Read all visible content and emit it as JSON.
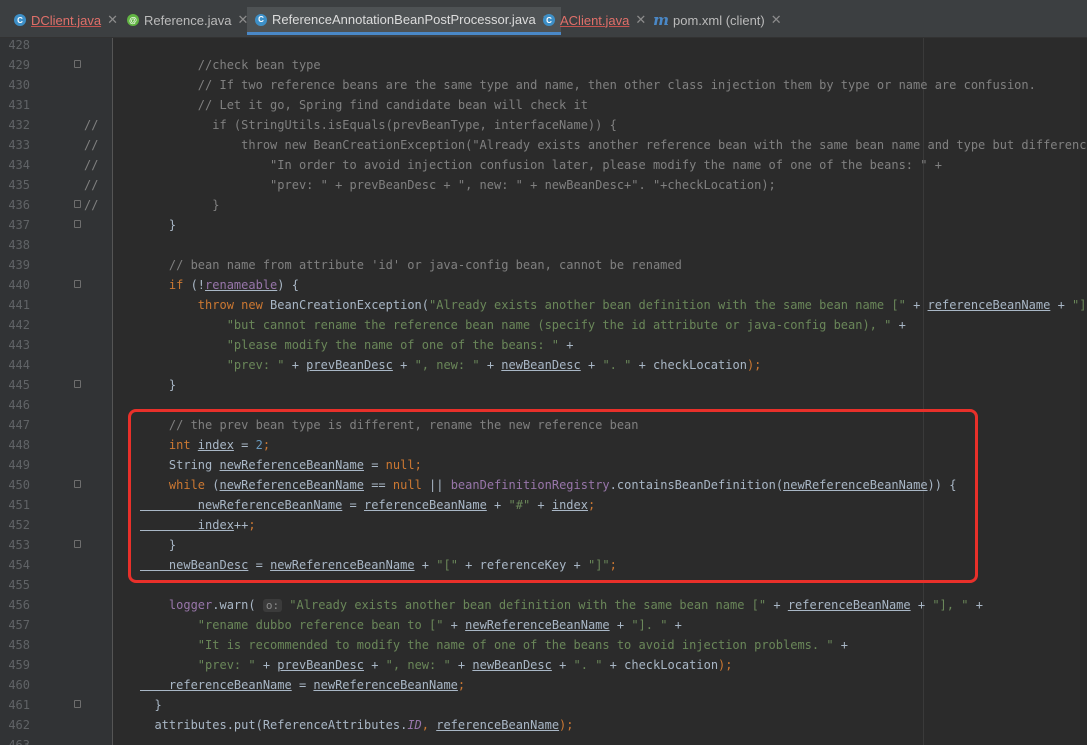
{
  "tabs": [
    {
      "label": "DClient.java",
      "icon": "class-icon",
      "glyph": "C",
      "modified": true,
      "active": false
    },
    {
      "label": "Reference.java",
      "icon": "annotation-icon",
      "glyph": "@",
      "modified": false,
      "active": false
    },
    {
      "label": "ReferenceAnnotationBeanPostProcessor.java",
      "icon": "class-icon",
      "glyph": "C",
      "modified": false,
      "active": true
    },
    {
      "label": "AClient.java",
      "icon": "class-icon",
      "glyph": "C",
      "modified": true,
      "active": false
    },
    {
      "label": "pom.xml (client)",
      "icon": "maven-icon",
      "glyph": "m",
      "modified": false,
      "active": false
    }
  ],
  "close_glyph": "✕",
  "lines": [
    {
      "n": "428",
      "fold": false,
      "mark": "",
      "segs": []
    },
    {
      "n": "429",
      "fold": true,
      "mark": "",
      "segs": [
        [
          "cm",
          "        //check bean type"
        ]
      ]
    },
    {
      "n": "430",
      "fold": false,
      "mark": "",
      "segs": [
        [
          "cm",
          "        // If two reference beans are the same type and name, then other class injection them by type or name are confusion."
        ]
      ]
    },
    {
      "n": "431",
      "fold": false,
      "mark": "",
      "segs": [
        [
          "cm",
          "        // Let it go, Spring find candidate bean will check it"
        ]
      ]
    },
    {
      "n": "432",
      "fold": false,
      "mark": "//",
      "segs": [
        [
          "cm",
          "          if (StringUtils.isEquals(prevBeanType, interfaceName)) {"
        ]
      ]
    },
    {
      "n": "433",
      "fold": false,
      "mark": "//",
      "segs": [
        [
          "cm",
          "              throw new BeanCreationException(\"Already exists another reference bean with the same bean name and type but difference attributes. \" +"
        ]
      ]
    },
    {
      "n": "434",
      "fold": false,
      "mark": "//",
      "segs": [
        [
          "cm",
          "                  \"In order to avoid injection confusion later, please modify the name of one of the beans: \" +"
        ]
      ]
    },
    {
      "n": "435",
      "fold": false,
      "mark": "//",
      "segs": [
        [
          "cm",
          "                  \"prev: \" + prevBeanDesc + \", new: \" + newBeanDesc+\". \"+checkLocation);"
        ]
      ]
    },
    {
      "n": "436",
      "fold": true,
      "mark": "//",
      "segs": [
        [
          "cm",
          "          }"
        ]
      ]
    },
    {
      "n": "437",
      "fold": true,
      "mark": "",
      "segs": [
        [
          "pl",
          "    }"
        ]
      ]
    },
    {
      "n": "438",
      "fold": false,
      "mark": "",
      "segs": []
    },
    {
      "n": "439",
      "fold": false,
      "mark": "",
      "segs": [
        [
          "cm",
          "    // bean name from attribute 'id' or java-config bean, cannot be renamed"
        ]
      ]
    },
    {
      "n": "440",
      "fold": true,
      "mark": "",
      "segs": [
        [
          "kw",
          "    if "
        ],
        [
          "pl",
          "(!"
        ],
        [
          "fdu",
          "renameable"
        ],
        [
          "pl",
          ") {"
        ]
      ]
    },
    {
      "n": "441",
      "fold": false,
      "mark": "",
      "segs": [
        [
          "kw",
          "        throw new "
        ],
        [
          "pl",
          "BeanCreationException("
        ],
        [
          "st",
          "\"Already exists another bean definition with the same bean name [\" "
        ],
        [
          "pl",
          "+ "
        ],
        [
          "ul",
          "referenceBeanName"
        ],
        [
          "pl",
          " + "
        ],
        [
          "st",
          "\"], \" "
        ],
        [
          "pl",
          "+"
        ]
      ]
    },
    {
      "n": "442",
      "fold": false,
      "mark": "",
      "segs": [
        [
          "st",
          "            \"but cannot rename the reference bean name (specify the id attribute or java-config bean), \" "
        ],
        [
          "pl",
          "+"
        ]
      ]
    },
    {
      "n": "443",
      "fold": false,
      "mark": "",
      "segs": [
        [
          "st",
          "            \"please modify the name of one of the beans: \" "
        ],
        [
          "pl",
          "+"
        ]
      ]
    },
    {
      "n": "444",
      "fold": false,
      "mark": "",
      "segs": [
        [
          "st",
          "            \"prev: \" "
        ],
        [
          "pl",
          "+ "
        ],
        [
          "ul",
          "prevBeanDesc"
        ],
        [
          "pl",
          " + "
        ],
        [
          "st",
          "\", new: \" "
        ],
        [
          "pl",
          "+ "
        ],
        [
          "ul",
          "newBeanDesc"
        ],
        [
          "pl",
          " + "
        ],
        [
          "st",
          "\". \" "
        ],
        [
          "pl",
          "+ checkLocation"
        ],
        [
          "kw",
          ");"
        ]
      ]
    },
    {
      "n": "445",
      "fold": true,
      "mark": "",
      "segs": [
        [
          "pl",
          "    }"
        ]
      ]
    },
    {
      "n": "446",
      "fold": false,
      "mark": "",
      "segs": []
    },
    {
      "n": "447",
      "fold": false,
      "mark": "",
      "segs": [
        [
          "cm",
          "    // the prev bean type is different, rename the new reference bean"
        ]
      ]
    },
    {
      "n": "448",
      "fold": false,
      "mark": "",
      "segs": [
        [
          "kw",
          "    int "
        ],
        [
          "ul",
          "index"
        ],
        [
          "pl",
          " = "
        ],
        [
          "nm",
          "2"
        ],
        [
          "kw",
          ";"
        ]
      ]
    },
    {
      "n": "449",
      "fold": false,
      "mark": "",
      "segs": [
        [
          "pl",
          "    String "
        ],
        [
          "ul",
          "newReferenceBeanName"
        ],
        [
          "pl",
          " = "
        ],
        [
          "kw",
          "null;"
        ]
      ]
    },
    {
      "n": "450",
      "fold": true,
      "mark": "",
      "segs": [
        [
          "kw",
          "    while "
        ],
        [
          "pl",
          "("
        ],
        [
          "ul",
          "newReferenceBeanName"
        ],
        [
          "pl",
          " == "
        ],
        [
          "kw",
          "null "
        ],
        [
          "pl",
          "|| "
        ],
        [
          "fd",
          "beanDefinitionRegistry"
        ],
        [
          "pl",
          ".containsBeanDefinition("
        ],
        [
          "ul",
          "newReferenceBeanName"
        ],
        [
          "pl",
          ")) {"
        ]
      ]
    },
    {
      "n": "451",
      "fold": false,
      "mark": "",
      "segs": [
        [
          "ul",
          "        newReferenceBeanName"
        ],
        [
          "pl",
          " = "
        ],
        [
          "ul",
          "referenceBeanName"
        ],
        [
          "pl",
          " + "
        ],
        [
          "st",
          "\"#\" "
        ],
        [
          "pl",
          "+ "
        ],
        [
          "ul",
          "index"
        ],
        [
          "kw",
          ";"
        ]
      ]
    },
    {
      "n": "452",
      "fold": false,
      "mark": "",
      "segs": [
        [
          "ul",
          "        index"
        ],
        [
          "pl",
          "++"
        ],
        [
          "kw",
          ";"
        ]
      ]
    },
    {
      "n": "453",
      "fold": true,
      "mark": "",
      "segs": [
        [
          "pl",
          "    }"
        ]
      ]
    },
    {
      "n": "454",
      "fold": false,
      "mark": "",
      "segs": [
        [
          "ul",
          "    newBeanDesc"
        ],
        [
          "pl",
          " = "
        ],
        [
          "ul",
          "newReferenceBeanName"
        ],
        [
          "pl",
          " + "
        ],
        [
          "st",
          "\"[\" "
        ],
        [
          "pl",
          "+ referenceKey + "
        ],
        [
          "st",
          "\"]\""
        ],
        [
          "kw",
          ";"
        ]
      ]
    },
    {
      "n": "455",
      "fold": false,
      "mark": "",
      "segs": []
    },
    {
      "n": "456",
      "fold": false,
      "mark": "",
      "segs": [
        [
          "fd",
          "    logger"
        ],
        [
          "pl",
          ".warn( "
        ],
        [
          "hint",
          "o:"
        ],
        [
          "st",
          " \"Already exists another bean definition with the same bean name [\" "
        ],
        [
          "pl",
          "+ "
        ],
        [
          "ul",
          "referenceBeanName"
        ],
        [
          "pl",
          " + "
        ],
        [
          "st",
          "\"], \" "
        ],
        [
          "pl",
          "+"
        ]
      ]
    },
    {
      "n": "457",
      "fold": false,
      "mark": "",
      "segs": [
        [
          "st",
          "        \"rename dubbo reference bean to [\" "
        ],
        [
          "pl",
          "+ "
        ],
        [
          "ul",
          "newReferenceBeanName"
        ],
        [
          "pl",
          " + "
        ],
        [
          "st",
          "\"]. \" "
        ],
        [
          "pl",
          "+"
        ]
      ]
    },
    {
      "n": "458",
      "fold": false,
      "mark": "",
      "segs": [
        [
          "st",
          "        \"It is recommended to modify the name of one of the beans to avoid injection problems. \" "
        ],
        [
          "pl",
          "+"
        ]
      ]
    },
    {
      "n": "459",
      "fold": false,
      "mark": "",
      "segs": [
        [
          "st",
          "        \"prev: \" "
        ],
        [
          "pl",
          "+ "
        ],
        [
          "ul",
          "prevBeanDesc"
        ],
        [
          "pl",
          " + "
        ],
        [
          "st",
          "\", new: \" "
        ],
        [
          "pl",
          "+ "
        ],
        [
          "ul",
          "newBeanDesc"
        ],
        [
          "pl",
          " + "
        ],
        [
          "st",
          "\". \" "
        ],
        [
          "pl",
          "+ checkLocation"
        ],
        [
          "kw",
          ");"
        ]
      ]
    },
    {
      "n": "460",
      "fold": false,
      "mark": "",
      "segs": [
        [
          "ul",
          "    referenceBeanName"
        ],
        [
          "pl",
          " = "
        ],
        [
          "ul",
          "newReferenceBeanName"
        ],
        [
          "kw",
          ";"
        ]
      ]
    },
    {
      "n": "461",
      "fold": true,
      "mark": "",
      "segs": [
        [
          "pl",
          "  }"
        ]
      ]
    },
    {
      "n": "462",
      "fold": false,
      "mark": "",
      "segs": [
        [
          "pl",
          "  attributes.put(ReferenceAttributes."
        ],
        [
          "fi",
          "ID"
        ],
        [
          "kw",
          ", "
        ],
        [
          "ul",
          "referenceBeanName"
        ],
        [
          "kw",
          ");"
        ]
      ]
    },
    {
      "n": "463",
      "fold": false,
      "mark": "",
      "segs": []
    }
  ]
}
